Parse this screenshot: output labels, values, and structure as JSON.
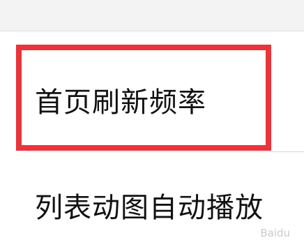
{
  "settings": {
    "items": [
      {
        "label": "首页刷新频率"
      },
      {
        "label": "列表动图自动播放"
      }
    ]
  },
  "annotation": {
    "highlight_color": "#e8343a"
  },
  "watermark": {
    "text": "Baidu"
  }
}
